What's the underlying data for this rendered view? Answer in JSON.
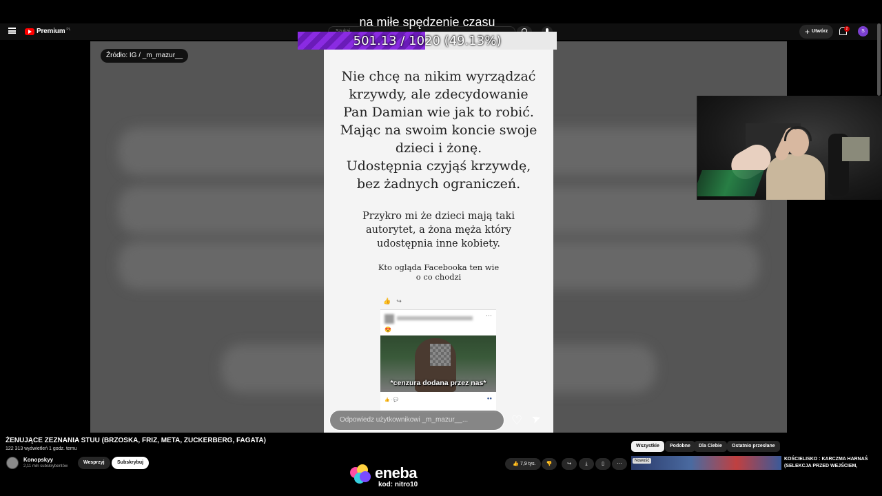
{
  "overlay": {
    "caption": "na miłe spędzenie czasu",
    "goal_text": "501.13 / 1020 (49.13%)",
    "goal_fraction": 0.4913
  },
  "header": {
    "logo_text": "Premium",
    "logo_region": "PL",
    "search_placeholder": "Szukaj",
    "create_label": "Utwórz",
    "notifications_count": "2",
    "avatar_letter": "S"
  },
  "player": {
    "source_label": "Źródło: IG / _m_mazur__",
    "post": {
      "headline": "Nie chcę na nikim wyrządzać krzywdy, ale zdecydowanie Pan Damian wie jak to robić. Mając na swoim koncie swoje dzieci i żonę. Udostępnia czyjąś krzywdę, bez żadnych ograniczeń.",
      "headline_lines": [
        "Nie chcę na nikim wyrządzać",
        "krzywdy, ale zdecydowanie",
        "Pan Damian wie jak to robić.",
        "Mając na swoim koncie swoje",
        "dzieci i żonę.",
        "Udostępnia czyjąś krzywdę,",
        "bez żadnych ograniczeń."
      ],
      "sub_lines": [
        "Przykro mi że dzieci mają taki",
        "autorytet, a żona męża który",
        "udostępnia inne kobiety."
      ],
      "small_lines": [
        "Kto ogląda Facebooka ten wie",
        "o co chodzi"
      ],
      "censor_caption": "*cenzura dodana przez nas*",
      "reply_placeholder": "Odpowiedz użytkownikowi _m_mazur__..."
    }
  },
  "video": {
    "title": "ŻENUJĄCE ZEZNANIA STUU (BRZOSKA, FRIZ, META, ZUCKERBERG, FAGATA)",
    "meta": "122 313 wyświetleń  1 godz. temu",
    "channel_name": "Konopskyy",
    "channel_subs": "2,11 mln subskrybentów",
    "support_label": "Wesprzyj",
    "subscribe_label": "Subskrybuj",
    "likes": "7,9 tys."
  },
  "chips": [
    "Wszystkie",
    "Podobne",
    "Dla Ciebie",
    "Ostatnio przesłane"
  ],
  "recommendation": {
    "badge": "Nowość",
    "title": "KOŚCIELISKO : KARCZMA HARNAŚ (SELEKCJA PRZED WEJŚCIEM, PŁATNA"
  },
  "sponsor": {
    "name": "eneba",
    "code": "kod: nitro10"
  },
  "colors": {
    "goal_fill": "#8a2be2",
    "yt_red": "#ff0000",
    "page_bg": "#0f0f0f"
  }
}
